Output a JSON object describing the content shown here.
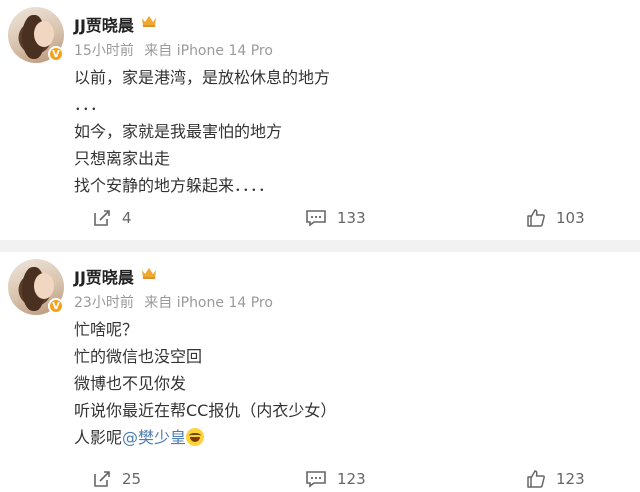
{
  "posts": [
    {
      "author": "JJ贾晓晨",
      "time": "15小时前",
      "source": "来自 iPhone 14 Pro",
      "lines": [
        "以前，家是港湾，是放松休息的地方",
        "．．．",
        "如今，家就是我最害怕的地方",
        "只想离家出走",
        "找个安静的地方躲起来．．．．"
      ],
      "reposts": "4",
      "comments": "133",
      "likes": "103"
    },
    {
      "author": "JJ贾晓晨",
      "time": "23小时前",
      "source": "来自 iPhone 14 Pro",
      "lines": [
        "忙啥呢？",
        "忙的微信也没空回",
        "微博也不见你发",
        "听说你最近在帮CC报仇（内衣少女）"
      ],
      "last_line_prefix": "人影呢",
      "mention": "@樊少皇",
      "emoji": "laughing-tears-emoji",
      "reposts": "25",
      "comments": "123",
      "likes": "123"
    }
  ],
  "colors": {
    "verified_badge": "#f7a11a",
    "crown": "#f0a830",
    "mention": "#4f7db1",
    "meta_text": "#9a9a9a"
  }
}
